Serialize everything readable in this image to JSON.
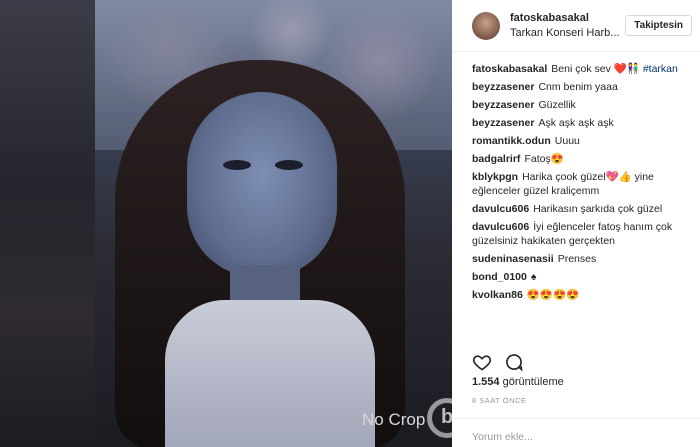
{
  "header": {
    "username": "fatoskabasakal",
    "location": "Tarkan Konseri Harb...",
    "follow_label": "Takiptesin"
  },
  "comments": [
    {
      "user": "fatoskabasakal",
      "text": "Beni çok sev ❤️👫 ",
      "tag": "#tarkan"
    },
    {
      "user": "beyzzasener",
      "text": "Cnm benim yaaa"
    },
    {
      "user": "beyzzasener",
      "text": "Güzellik"
    },
    {
      "user": "beyzzasener",
      "text": "Aşk aşk aşk aşk"
    },
    {
      "user": "romantikk.odun",
      "text": "Uuuu"
    },
    {
      "user": "badgalrirf",
      "text": "Fatoş😍"
    },
    {
      "user": "kblykpgn",
      "text": "Harika çook güzel💖👍 yine eğlenceler güzel kraliçemm"
    },
    {
      "user": "davulcu606",
      "text": "Harikasın şarkıda çok güzel"
    },
    {
      "user": "davulcu606",
      "text": "İyi eğlenceler fatoş hanım çok güzelsiniz hakikaten gerçekten"
    },
    {
      "user": "sudeninasenasii",
      "text": "Prenses"
    },
    {
      "user": "bond_0100",
      "text": "♠"
    },
    {
      "user": "kvolkan86",
      "text": "😍😍😍😍"
    }
  ],
  "stats": {
    "views_count": "1.554",
    "views_label": "görüntüleme",
    "time_ago": "8 SAAT ÖNCE"
  },
  "add_comment": {
    "placeholder": "Yorum ekle..."
  },
  "media": {
    "watermark": "No Crop",
    "watermark_logo": "b"
  },
  "icons": {
    "like": "heart-icon",
    "comment": "comment-bubble-icon"
  }
}
